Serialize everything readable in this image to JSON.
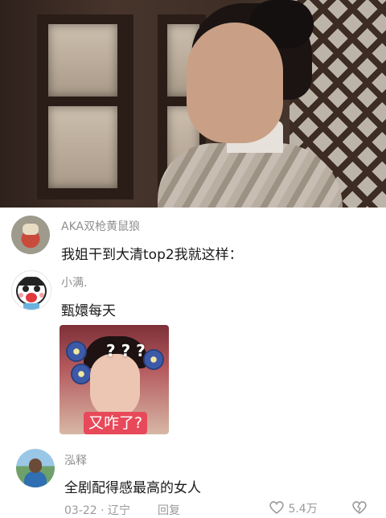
{
  "comments": [
    {
      "author": "AKA双枪黄鼠狼",
      "text": "我姐干到大清top2我就这样："
    },
    {
      "author": "小满.",
      "text": "甄嬛每天",
      "sticker": {
        "question_marks": "? ? ?",
        "caption": "又咋了?"
      }
    },
    {
      "author": "泓释",
      "text": "全剧配得感最高的女人"
    }
  ],
  "footer": {
    "meta": "03-22 · 辽宁",
    "reply_label": "回复",
    "like_count": "5.4万"
  }
}
